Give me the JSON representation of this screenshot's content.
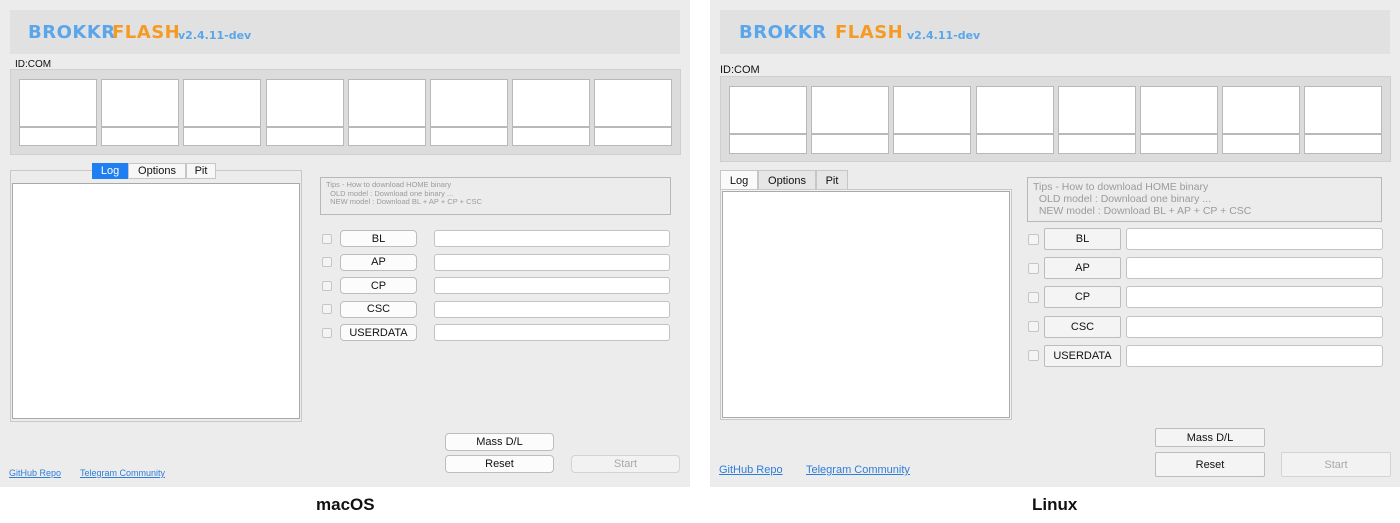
{
  "app": {
    "brand_part1": "BROKKR",
    "brand_part2": "FLASH",
    "version": "v2.4.11-dev"
  },
  "id_com_label": "ID:COM",
  "tabs": [
    "Log",
    "Options",
    "Pit"
  ],
  "tips": "Tips - How to download HOME binary\n  OLD model : Download one binary ...\n  NEW model : Download BL + AP + CP + CSC",
  "files": [
    {
      "label": "BL"
    },
    {
      "label": "AP"
    },
    {
      "label": "CP"
    },
    {
      "label": "CSC"
    },
    {
      "label": "USERDATA"
    }
  ],
  "buttons": {
    "mass_dl": "Mass D/L",
    "reset": "Reset",
    "start": "Start"
  },
  "links": {
    "github": "GitHub Repo",
    "telegram": "Telegram Community"
  },
  "captions": {
    "mac": "macOS",
    "linux": "Linux"
  },
  "colors": {
    "brand_blue": "#5aa6ea",
    "brand_orange": "#f59b25",
    "mac_tab_active": "#1f7ff0",
    "link": "#2f7ed8"
  }
}
